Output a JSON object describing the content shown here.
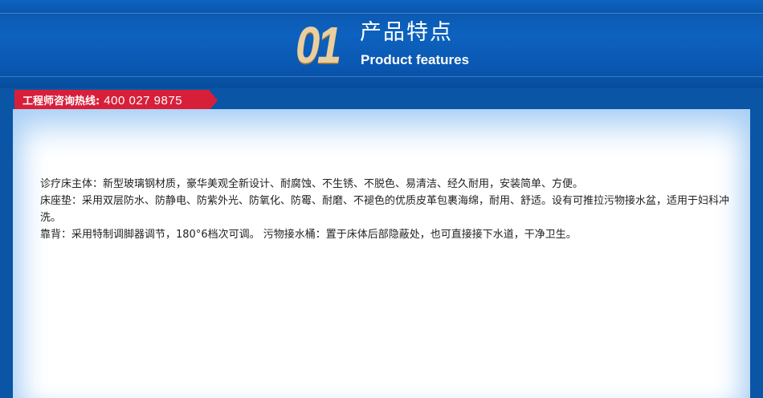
{
  "header": {
    "number": "01",
    "title_cn": "产品特点",
    "title_en": "Product features"
  },
  "hotline": {
    "label": "工程师咨询热线:",
    "phone": "400 027 9875"
  },
  "colors": {
    "banner_blue": "#0b55a6",
    "hotline_red": "#d81f3a",
    "number_gold": "#e9cfa0"
  },
  "content": {
    "paragraphs": [
      "诊疗床主体：新型玻璃钢材质，豪华美观全新设计、耐腐蚀、不生锈、不脱色、易清洁、经久耐用，安装简单、方便。",
      "床座垫：采用双层防水、防静电、防紫外光、防氧化、防霉、耐磨、不褪色的优质皮革包裹海绵，耐用、舒适。设有可推拉污物接水盆，适用于妇科冲洗。",
      "靠背：采用特制调脚器调节，180°6档次可调。 污物接水桶：置于床体后部隐蔽处，也可直接接下水道，干净卫生。"
    ]
  }
}
